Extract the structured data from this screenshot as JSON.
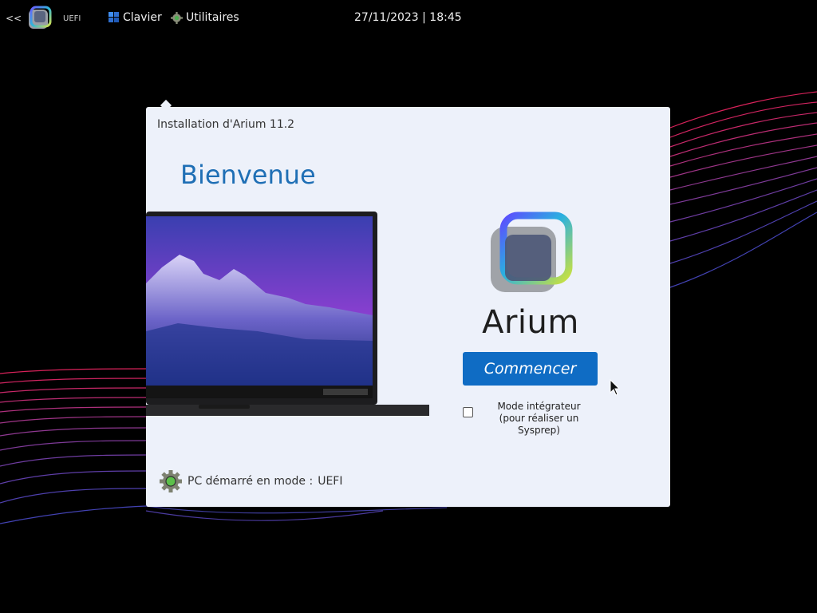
{
  "topbar": {
    "back_label": "<<",
    "mode_label": "UEFI",
    "keyboard_label": "Clavier",
    "utilities_label": "Utilitaires",
    "datetime": "27/11/2023 | 18:45"
  },
  "dialog": {
    "title": "Installation d'Arium 11.2",
    "welcome": "Bienvenue",
    "brand_name": "Arium",
    "start_button_label": "Commencer",
    "integrator_line1": "Mode intégrateur",
    "integrator_line2": "(pour réaliser un Sysprep)",
    "integrator_checked": false,
    "boot_mode_label": "PC démarré en mode :",
    "boot_mode_value": "UEFI"
  },
  "colors": {
    "accent": "#0f6cc4",
    "welcome_text": "#1f6fb5",
    "dialog_background": "#edf1fa",
    "desktop_background": "#000000"
  },
  "icons": {
    "back": "double-chevron-left-icon",
    "app_logo": "arium-logo-icon",
    "keyboard": "keyboard-grid-icon",
    "utilities": "gear-icon",
    "boot_status": "gear-status-icon",
    "cursor": "mouse-pointer-icon"
  }
}
